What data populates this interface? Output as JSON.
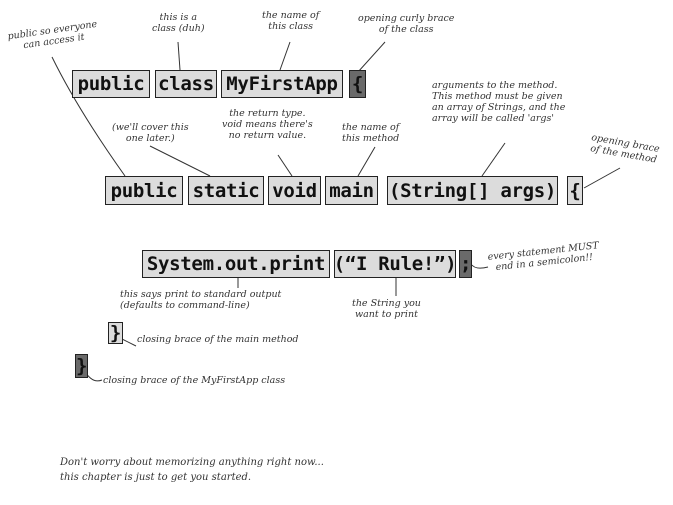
{
  "code": {
    "class_line": {
      "public": "public",
      "class": "class",
      "name": "MyFirstApp",
      "open_brace": "{"
    },
    "main_line": {
      "public": "public",
      "static": "static",
      "void": "void",
      "main": "main",
      "args": "(String[] args)",
      "open_brace": "{"
    },
    "print_line": {
      "call": "System.out.print",
      "arg": "(“I Rule!”)",
      "semicolon": ";"
    },
    "close_main": "}",
    "close_class": "}"
  },
  "notes": {
    "public_note": "public so everyone\ncan access it",
    "class_note": "this is a\nclass (duh)",
    "name_note": "the name of\nthis class",
    "brace_note": "opening curly brace\nof the class",
    "later_note": "(we'll cover this\none later.)",
    "return_note": "the return type.\nvoid means there's\nno return value.",
    "method_name_note": "the name of\nthis method",
    "args_note": "arguments to the method.\nThis method must be given\nan array of Strings, and the\narray will be called 'args'",
    "method_brace_note": "opening brace\nof the method",
    "semicolon_note": "every statement MUST\nend in a semicolon!!",
    "print_note": "this says print to standard output\n(defaults to command-line)",
    "string_note": "the String you\nwant to print",
    "close_main_note": "closing brace of the main method",
    "close_class_note": "closing brace of the MyFirstApp class"
  },
  "footer": "Don't worry about memorizing anything right now...\nthis chapter is just to get you started."
}
